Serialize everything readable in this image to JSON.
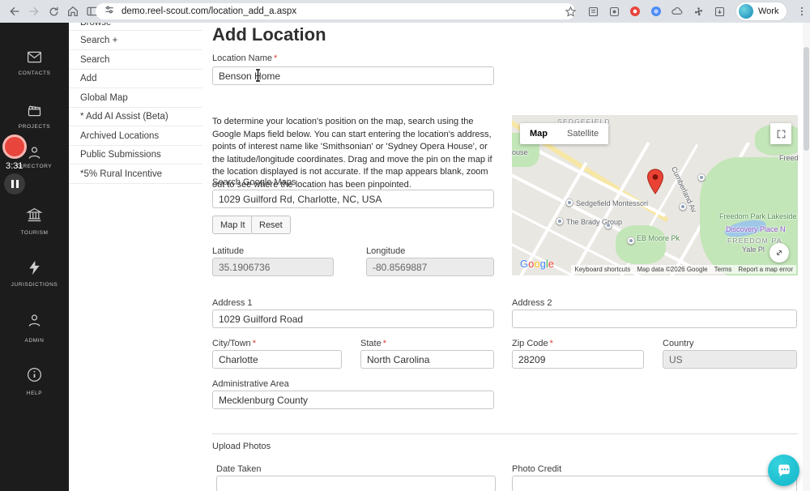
{
  "browser": {
    "url": "demo.reel-scout.com/location_add_a.aspx",
    "profile_label": "Work"
  },
  "recorder": {
    "time": "3:31"
  },
  "sidebar": {
    "items": [
      {
        "label": "CONTACTS",
        "icon": "envelope"
      },
      {
        "label": "PROJECTS",
        "icon": "clapperboard"
      },
      {
        "label": "DIRECTORY",
        "icon": "person"
      },
      {
        "label": "TOURISM",
        "icon": "landmark"
      },
      {
        "label": "JURISDICTIONS",
        "icon": "lightning"
      },
      {
        "label": "ADMIN",
        "icon": "person"
      },
      {
        "label": "HELP",
        "icon": "info-circle"
      }
    ]
  },
  "submenu": {
    "items": [
      "Browse",
      "Search +",
      "Search",
      "Add",
      "Global Map",
      "* Add AI Assist (Beta)",
      "Archived Locations",
      "Public Submissions",
      "*5% Rural Incentive"
    ]
  },
  "page": {
    "title": "Add Location",
    "required_marker": "*",
    "map_help": "To determine your location's position on the map, search using the Google Maps field below. You can start entering the location's address, points of interest name like 'Smithsonian' or 'Sydney Opera House', or the latitude/longitude coordinates. Drag and move the pin on the map if the location displayed is not accurate. If the map appears blank, zoom out to see where the location has been pinpointed.",
    "buttons": {
      "map_it": "Map It",
      "reset": "Reset"
    },
    "sections": {
      "upload_photos": "Upload Photos"
    },
    "fields": {
      "location_name": {
        "label": "Location Name",
        "value": "Benson Home"
      },
      "search_maps": {
        "label": "Search Google Maps",
        "value": "1029 Guilford Rd, Charlotte, NC, USA"
      },
      "latitude": {
        "label": "Latitude",
        "value": "35.1906736"
      },
      "longitude": {
        "label": "Longitude",
        "value": "-80.8569887"
      },
      "address1": {
        "label": "Address 1",
        "value": "1029 Guilford Road"
      },
      "address2": {
        "label": "Address 2",
        "value": ""
      },
      "city": {
        "label": "City/Town",
        "value": "Charlotte"
      },
      "state": {
        "label": "State",
        "value": "North Carolina"
      },
      "zip": {
        "label": "Zip Code",
        "value": "28209"
      },
      "country": {
        "label": "Country",
        "value": "US"
      },
      "admin_area": {
        "label": "Administrative Area",
        "value": "Mecklenburg County"
      },
      "date_taken": {
        "label": "Date Taken",
        "value": ""
      },
      "photo_credit": {
        "label": "Photo Credit",
        "value": ""
      }
    }
  },
  "map": {
    "controls": {
      "map": "Map",
      "satellite": "Satellite"
    },
    "labels": [
      {
        "text": "SEDGEFIELD"
      },
      {
        "text": "ouse"
      },
      {
        "text": "Freedo"
      },
      {
        "text": "Sedgefield Montessori"
      },
      {
        "text": "The Brady Group"
      },
      {
        "text": "EB Moore Pk"
      },
      {
        "text": "Freedom Park Lakeside"
      },
      {
        "text": "Discovery Place N"
      },
      {
        "text": "FREEDOM PA"
      },
      {
        "text": "Yale Pl"
      },
      {
        "text": "Cumberland Av"
      }
    ],
    "logo_letters": [
      {
        "ch": "G"
      },
      {
        "ch": "o"
      },
      {
        "ch": "o"
      },
      {
        "ch": "g"
      },
      {
        "ch": "l"
      },
      {
        "ch": "e"
      }
    ],
    "attribution": [
      "Keyboard shortcuts",
      "Map data ©2026 Google",
      "Terms",
      "Report a map error"
    ]
  },
  "colors": {
    "pin": "#EA4335",
    "required": "#e03c31",
    "chat_accent": "#12b4c9",
    "park_green": "#c3e6b8"
  }
}
